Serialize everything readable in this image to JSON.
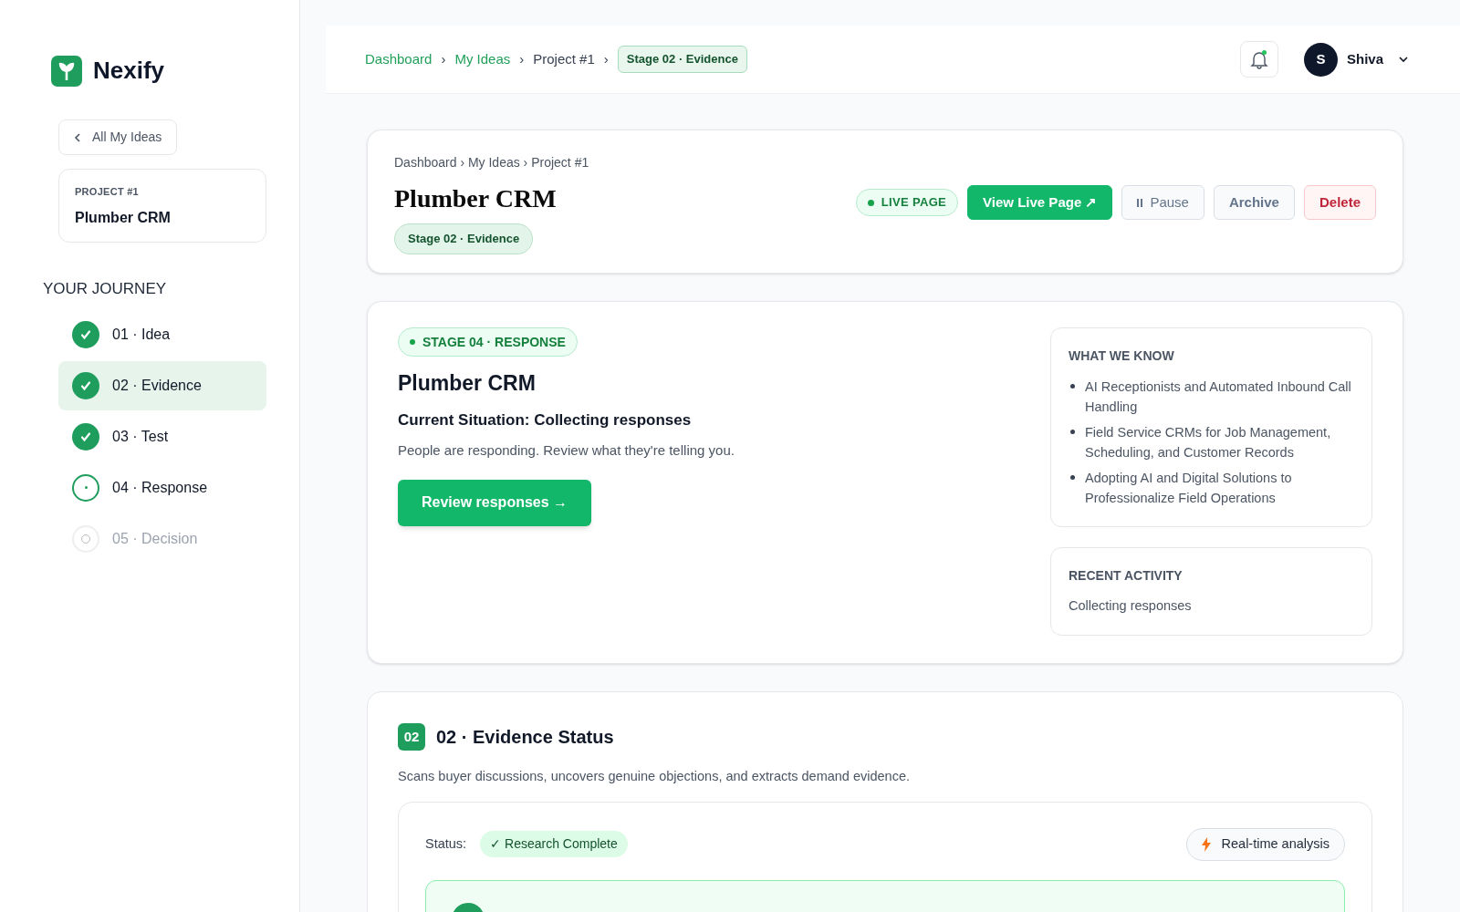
{
  "brand": {
    "name": "Nexify"
  },
  "sidebar": {
    "back_button": "All My Ideas",
    "project": {
      "label": "PROJECT #1",
      "name": "Plumber CRM"
    },
    "journey_title": "YOUR JOURNEY",
    "steps": [
      {
        "label": "01 · Idea",
        "kind": "done",
        "selected": false
      },
      {
        "label": "02 · Evidence",
        "kind": "done",
        "selected": true
      },
      {
        "label": "03 · Test",
        "kind": "done",
        "selected": false
      },
      {
        "label": "04 · Response",
        "kind": "current",
        "selected": false
      },
      {
        "label": "05 · Decision",
        "kind": "pending",
        "selected": false
      }
    ]
  },
  "header": {
    "breadcrumbs": [
      {
        "label": "Dashboard",
        "kind": "link"
      },
      {
        "label": "My Ideas",
        "kind": "link"
      },
      {
        "label": "Project #1",
        "kind": "text"
      },
      {
        "label": "Stage 02 · Evidence",
        "kind": "badge"
      }
    ],
    "separator": "›",
    "notification_dot": true,
    "user": {
      "initial": "S",
      "name": "Shiva"
    }
  },
  "project_card": {
    "breadcrumb": "Dashboard › My Ideas › Project #1",
    "title": "Plumber CRM",
    "stage_badge": "Stage 02 · Evidence",
    "live_badge": "LIVE PAGE",
    "actions": [
      {
        "label": "View Live Page ↗",
        "kind": "primary"
      },
      {
        "label": "Pause",
        "kind": "pause"
      },
      {
        "label": "Archive",
        "kind": "secondary"
      },
      {
        "label": "Delete",
        "kind": "danger"
      }
    ]
  },
  "stage_card": {
    "badge": "STAGE 04 · RESPONSE",
    "title": "Plumber CRM",
    "situation": "Current Situation: Collecting responses",
    "description": "People are responding. Review what they're telling you.",
    "button": "Review responses →",
    "what_we_know": {
      "title": "WHAT WE KNOW",
      "items": [
        "AI Receptionists and Automated Inbound Call Handling",
        "Field Service CRMs for Job Management, Scheduling, and Customer Records",
        "Adopting AI and Digital Solutions to Professionalize Field Operations"
      ]
    },
    "recent_activity": {
      "title": "RECENT ACTIVITY",
      "text": "Collecting responses"
    }
  },
  "evidence_card": {
    "number": "02",
    "title": "02 · Evidence Status",
    "description": "Scans buyer discussions, uncovers genuine objections, and extracts demand evidence.",
    "status_label": "Status:",
    "status_badge": "✓ Research Complete",
    "analysis_button": "Real-time analysis"
  }
}
